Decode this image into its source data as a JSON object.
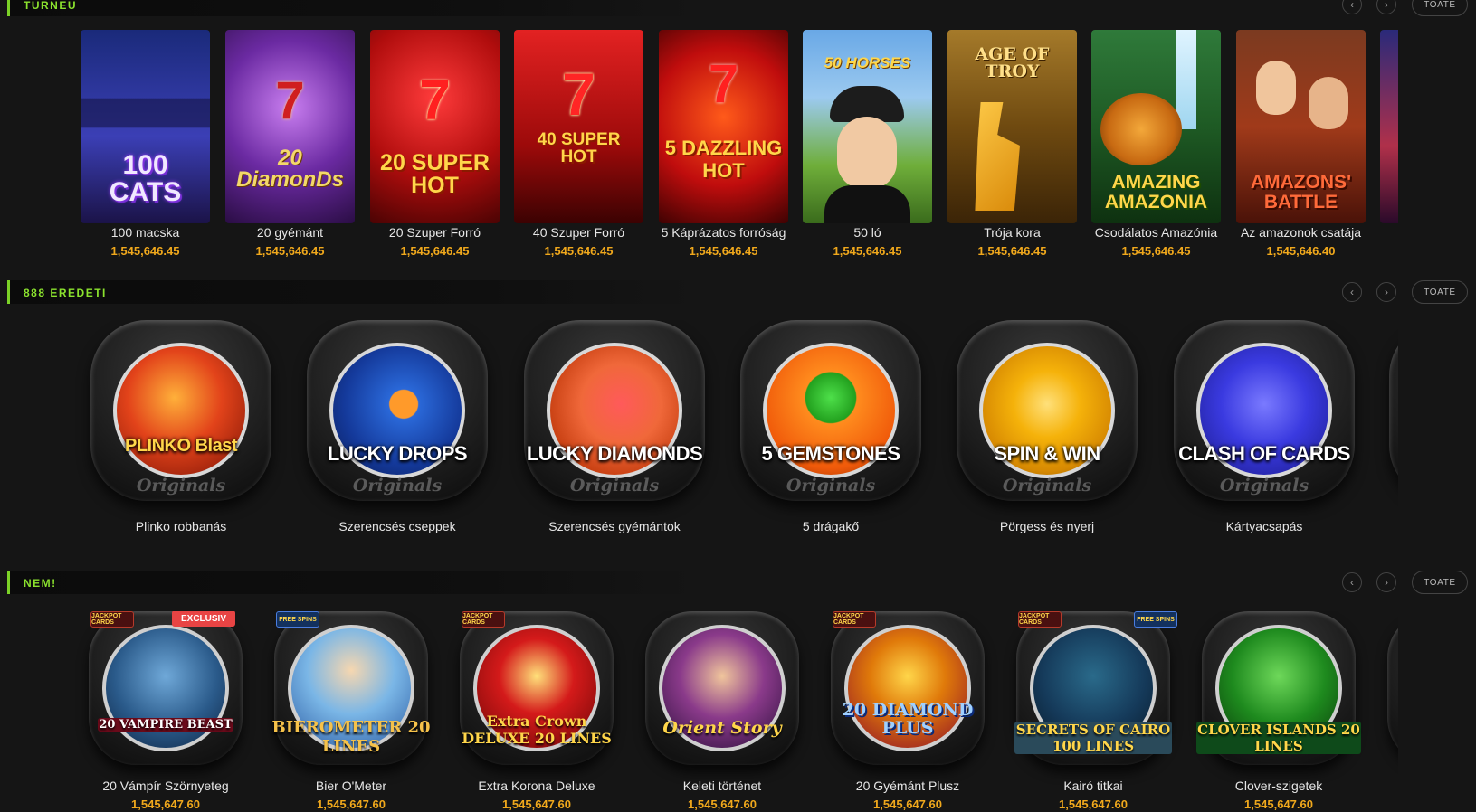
{
  "sections": {
    "turneu": {
      "title": "TURNEU",
      "all_label": "TOATE"
    },
    "originals": {
      "title": "888 EREDETI",
      "all_label": "TOATE"
    },
    "new": {
      "title": "NEM!",
      "all_label": "TOATE"
    }
  },
  "nav": {
    "prev_icon": "chevron-left-icon",
    "next_icon": "chevron-right-icon"
  },
  "tournament_games": [
    {
      "art": "100 CATS",
      "name": "100 macska",
      "jackpot": "1,545,646.45"
    },
    {
      "art": "20 DiamonDs",
      "name": "20 gyémánt",
      "jackpot": "1,545,646.45"
    },
    {
      "art": "20 SUPER HOT",
      "name": "20 Szuper Forró",
      "jackpot": "1,545,646.45"
    },
    {
      "art": "40 SUPER HOT",
      "name": "40 Szuper Forró",
      "jackpot": "1,545,646.45"
    },
    {
      "art": "5 DAZZLING HOT",
      "name": "5 Káprázatos forróság",
      "jackpot": "1,545,646.45"
    },
    {
      "art": "50 HORSES",
      "name": "50 ló",
      "jackpot": "1,545,646.45"
    },
    {
      "art": "AGE OF TROY",
      "name": "Trója kora",
      "jackpot": "1,545,646.45"
    },
    {
      "art": "AMAZING AMAZONIA",
      "name": "Csodálatos Amazónia",
      "jackpot": "1,545,646.45"
    },
    {
      "art": "AMAZONS' BATTLE",
      "name": "Az amazonok csatája",
      "jackpot": "1,545,646.40"
    }
  ],
  "originals": {
    "sub_label": "Originals",
    "items": [
      {
        "art": "PLINKO Blast",
        "name": "Plinko robbanás"
      },
      {
        "art": "LUCKY DROPS",
        "name": "Szerencsés cseppek"
      },
      {
        "art": "LUCKY DIAMONDS",
        "name": "Szerencsés gyémántok"
      },
      {
        "art": "5 GEMSTONES",
        "name": "5 drágakő"
      },
      {
        "art": "SPIN & WIN",
        "name": "Pörgess és nyerj"
      },
      {
        "art": "CLASH OF CARDS",
        "name": "Kártyacsapás"
      }
    ]
  },
  "new_games": {
    "exclusive_label": "EXCLUSIV",
    "jackpot_badge": "JACKPOT CARDS",
    "free_badge": "FREE SPINS",
    "items": [
      {
        "art": "20 VAMPIRE BEAST",
        "name": "20 Vámpír Szörnyeteg",
        "jackpot": "1,545,647.60"
      },
      {
        "art": "BIEROMETER 20 LINES",
        "name": "Bier O'Meter",
        "jackpot": "1,545,647.60"
      },
      {
        "art": "Extra Crown DELUXE 20 LINES",
        "name": "Extra Korona Deluxe",
        "jackpot": "1,545,647.60"
      },
      {
        "art": "Orient Story",
        "name": "Keleti történet",
        "jackpot": "1,545,647.60"
      },
      {
        "art": "20 DIAMOND PLUS",
        "name": "20 Gyémánt Plusz",
        "jackpot": "1,545,647.60"
      },
      {
        "art": "SECRETS OF CAIRO 100 LINES",
        "name": "Kairó titkai",
        "jackpot": "1,545,647.60"
      },
      {
        "art": "CLOVER ISLANDS 20 LINES",
        "name": "Clover-szigetek",
        "jackpot": "1,545,647.60"
      }
    ]
  },
  "colors": {
    "accent": "#7cd227",
    "jackpot": "#f0a81c",
    "background": "#151515",
    "exclusive": "#e84444"
  }
}
